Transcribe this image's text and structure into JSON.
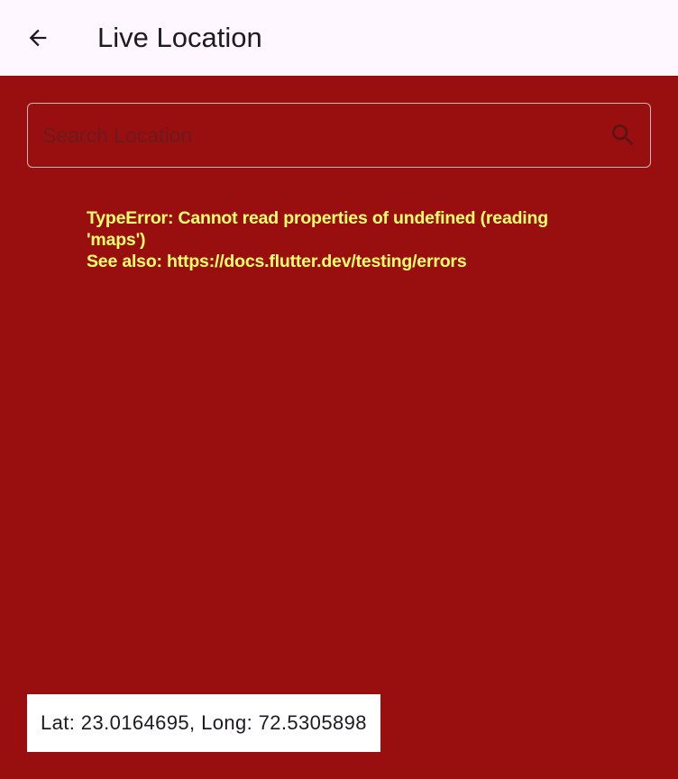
{
  "appbar": {
    "title": "Live Location",
    "back_icon": "arrow-left-icon"
  },
  "search": {
    "placeholder": "Search Location",
    "value": "",
    "icon": "search-icon"
  },
  "error": {
    "line1": "TypeError: Cannot read properties of undefined (reading 'maps')",
    "line2": "See also: https://docs.flutter.dev/testing/errors"
  },
  "location": {
    "text": "Lat: 23.0164695, Long: 72.5305898"
  },
  "colors": {
    "error_background": "#990f10",
    "error_text": "#ffff6b",
    "appbar_background": "#fef7ff"
  }
}
